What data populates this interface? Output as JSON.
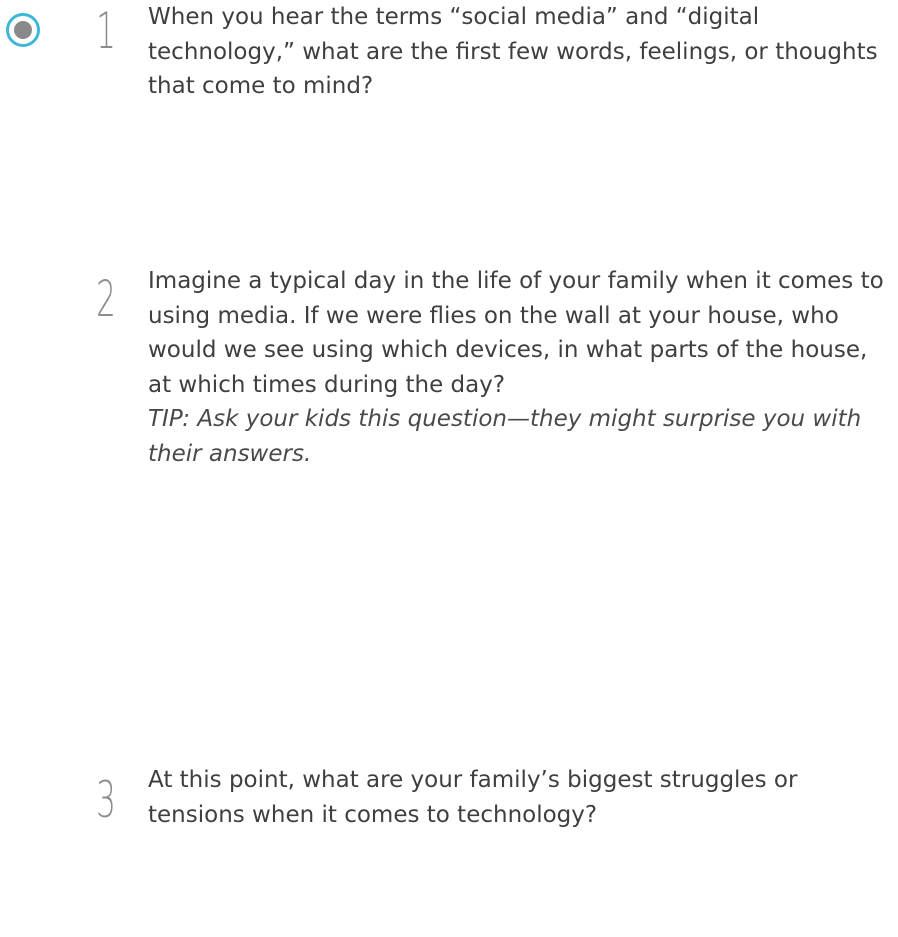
{
  "questions": [
    {
      "number": "1",
      "text": "When you hear the terms “social media” and “digital technology,” what are the first few words, feelings, or thoughts that come to mind?"
    },
    {
      "number": "2",
      "text": "Imagine a typical day in the life of your family when it comes to using media. If we were flies on the wall at your house, who would we see using which devices, in what parts of the house, at which times during the day?",
      "tip": "TIP: Ask your kids this question—they might surprise you with their answers."
    },
    {
      "number": "3",
      "text": "At this point, what are your family’s biggest struggles or tensions when it comes to technology?"
    }
  ],
  "colors": {
    "accent": "#3fb7d6",
    "radio_dot": "#8a8a8a",
    "text": "#3f3f3f",
    "number": "#8c8c8c"
  },
  "icons": {
    "selector": "radio-selected-icon"
  }
}
